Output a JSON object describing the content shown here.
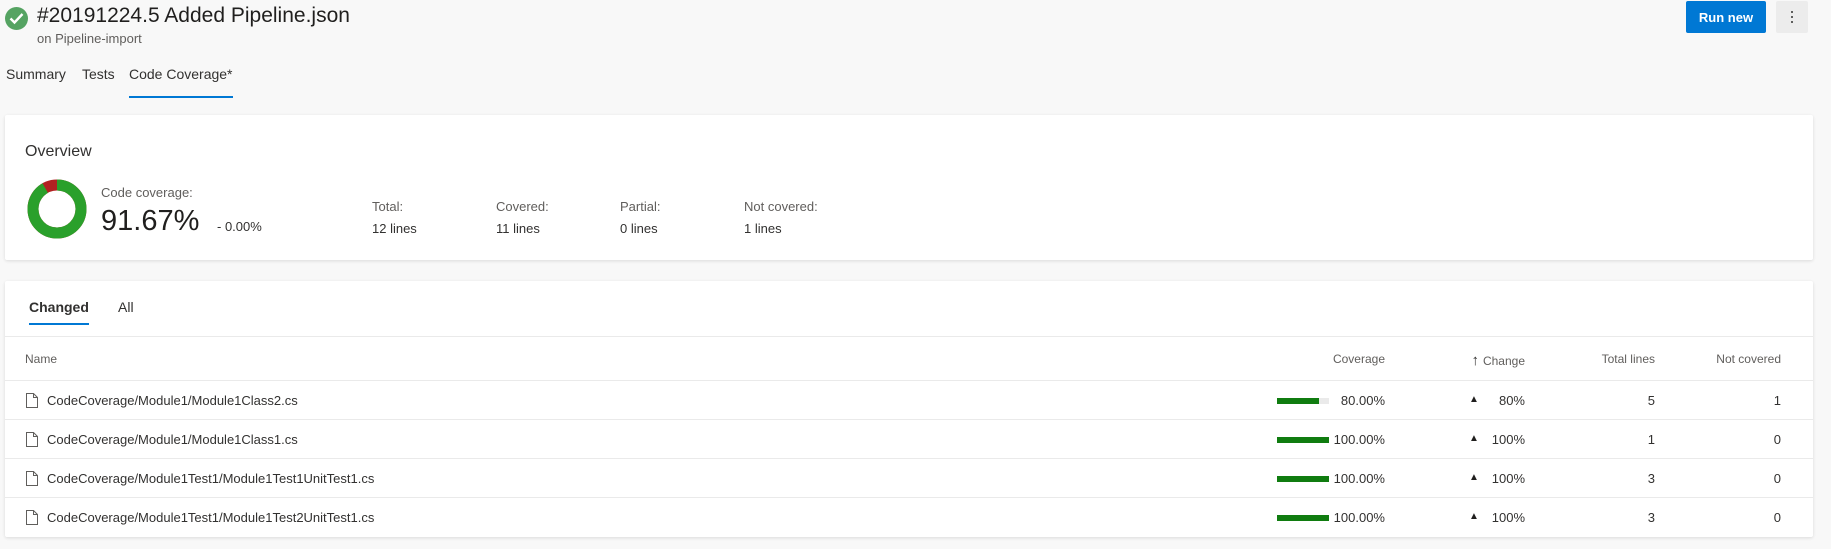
{
  "header": {
    "title": "#20191224.5 Added Pipeline.json",
    "subtitle": "on Pipeline-import",
    "status_color": "#55a362",
    "run_button": "Run new",
    "more_icon": "more-vertical-icon"
  },
  "tabs": [
    {
      "label": "Summary",
      "active": false
    },
    {
      "label": "Tests",
      "active": false
    },
    {
      "label": "Code Coverage*",
      "active": true
    }
  ],
  "overview": {
    "title": "Overview",
    "coverage_label": "Code coverage:",
    "coverage_value": "91.67%",
    "coverage_change": "-  0.00%",
    "donut": {
      "covered_fraction": 0.9167,
      "covered_color": "#2aa02b",
      "uncovered_color": "#b22222"
    },
    "stats": [
      {
        "label": "Total:",
        "value": "12 lines"
      },
      {
        "label": "Covered:",
        "value": "11 lines"
      },
      {
        "label": "Partial:",
        "value": "0 lines"
      },
      {
        "label": "Not covered:",
        "value": "1 lines"
      }
    ]
  },
  "files": {
    "subtabs": [
      {
        "label": "Changed",
        "active": true
      },
      {
        "label": "All",
        "active": false
      }
    ],
    "columns": {
      "name": "Name",
      "coverage": "Coverage",
      "change": "Change",
      "change_sort_icon": "arrow-up-icon",
      "total_lines": "Total lines",
      "not_covered": "Not covered"
    },
    "rows": [
      {
        "name": "CodeCoverage/Module1/Module1Class2.cs",
        "coverage": "80.00%",
        "coverage_fraction": 0.8,
        "change": "80%",
        "total_lines": "5",
        "not_covered": "1"
      },
      {
        "name": "CodeCoverage/Module1/Module1Class1.cs",
        "coverage": "100.00%",
        "coverage_fraction": 1.0,
        "change": "100%",
        "total_lines": "1",
        "not_covered": "0"
      },
      {
        "name": "CodeCoverage/Module1Test1/Module1Test1UnitTest1.cs",
        "coverage": "100.00%",
        "coverage_fraction": 1.0,
        "change": "100%",
        "total_lines": "3",
        "not_covered": "0"
      },
      {
        "name": "CodeCoverage/Module1Test1/Module1Test2UnitTest1.cs",
        "coverage": "100.00%",
        "coverage_fraction": 1.0,
        "change": "100%",
        "total_lines": "3",
        "not_covered": "0"
      }
    ]
  }
}
